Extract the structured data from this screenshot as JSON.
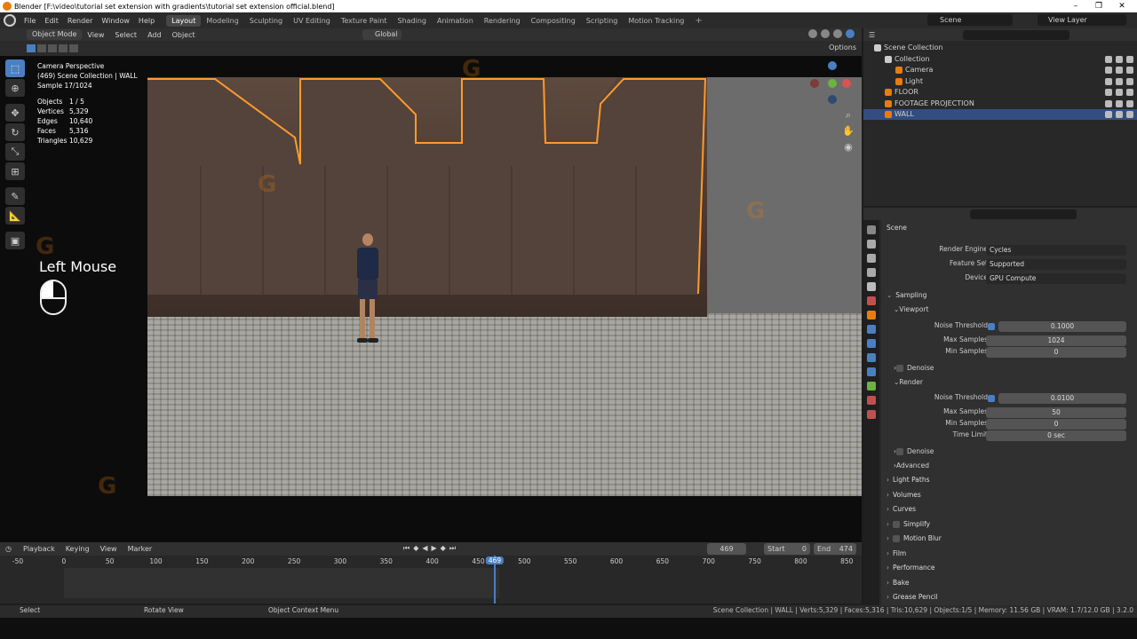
{
  "titlebar": {
    "title": "Blender [F:\\video\\tutorial set extension with gradients\\tutorial set extension official.blend]",
    "min": "–",
    "max": "❐",
    "close": "✕"
  },
  "menubar": {
    "menus": [
      "File",
      "Edit",
      "Render",
      "Window",
      "Help"
    ],
    "workspaces": [
      "Layout",
      "Modeling",
      "Sculpting",
      "UV Editing",
      "Texture Paint",
      "Shading",
      "Animation",
      "Rendering",
      "Compositing",
      "Scripting",
      "Motion Tracking"
    ],
    "active_workspace": "Layout",
    "add": "+",
    "scene": "Scene",
    "view_layer": "View Layer"
  },
  "viewport_header": {
    "mode": "Object Mode",
    "menus": [
      "View",
      "Select",
      "Add",
      "Object"
    ],
    "orientation": "Global",
    "options": "Options"
  },
  "viewport": {
    "info": {
      "perspective": "Camera Perspective",
      "collection": "(469) Scene Collection | WALL",
      "sample": "Sample 17/1024"
    },
    "stats": [
      {
        "label": "Objects",
        "value": "1 / 5"
      },
      {
        "label": "Vertices",
        "value": "5,329"
      },
      {
        "label": "Edges",
        "value": "10,640"
      },
      {
        "label": "Faces",
        "value": "5,316"
      },
      {
        "label": "Triangles",
        "value": "10,629"
      }
    ],
    "overlay_text": "Left Mouse",
    "tools": [
      "select-box-icon",
      "cursor-icon",
      "move-icon",
      "rotate-icon",
      "scale-icon",
      "transform-icon",
      "annotate-icon",
      "measure-icon",
      "add-cube-icon"
    ]
  },
  "timeline": {
    "menus": [
      "Playback",
      "Keying",
      "View",
      "Marker"
    ],
    "current_frame": "469",
    "start_label": "Start",
    "start": "0",
    "end_label": "End",
    "end": "474",
    "ruler": [
      "-50",
      "0",
      "50",
      "100",
      "150",
      "200",
      "250",
      "300",
      "350",
      "400",
      "450",
      "469",
      "500",
      "550",
      "600",
      "650",
      "700",
      "750",
      "800",
      "850"
    ],
    "playhead_frame": 469
  },
  "statusbar": {
    "select": "Select",
    "rotate": "Rotate View",
    "context": "Object Context Menu",
    "stats": "Scene Collection | WALL | Verts:5,329 | Faces:5,316 | Tris:10,629 | Objects:1/5 | Memory: 11.56 GB | VRAM: 1.7/12.0 GB | 3.2.0"
  },
  "outliner": {
    "items": [
      {
        "label": "Scene Collection",
        "indent": 0,
        "icon_color": "#cccccc",
        "selected": false
      },
      {
        "label": "Collection",
        "indent": 1,
        "icon_color": "#cccccc",
        "selected": false
      },
      {
        "label": "Camera",
        "indent": 2,
        "icon_color": "#e87d0d",
        "selected": false
      },
      {
        "label": "Light",
        "indent": 2,
        "icon_color": "#e87d0d",
        "selected": false
      },
      {
        "label": "FLOOR",
        "indent": 1,
        "icon_color": "#e87d0d",
        "selected": false
      },
      {
        "label": "FOOTAGE PROJECTION",
        "indent": 1,
        "icon_color": "#e87d0d",
        "selected": false
      },
      {
        "label": "WALL",
        "indent": 1,
        "icon_color": "#e87d0d",
        "selected": true
      }
    ]
  },
  "properties": {
    "scene": "Scene",
    "render_engine_label": "Render Engine",
    "render_engine": "Cycles",
    "feature_set_label": "Feature Set",
    "feature_set": "Supported",
    "device_label": "Device",
    "device": "GPU Compute",
    "sampling": "Sampling",
    "viewport": "Viewport",
    "render": "Render",
    "noise_threshold_label": "Noise Threshold",
    "max_samples_label": "Max Samples",
    "min_samples_label": "Min Samples",
    "time_limit_label": "Time Limit",
    "viewport_noise": "0.1000",
    "viewport_max": "1024",
    "viewport_min": "0",
    "render_noise": "0.0100",
    "render_max": "50",
    "render_min": "0",
    "render_time_limit": "0 sec",
    "denoise": "Denoise",
    "advanced": "Advanced",
    "sections": [
      "Light Paths",
      "Volumes",
      "Curves",
      "Simplify",
      "Motion Blur",
      "Film",
      "Performance",
      "Bake",
      "Grease Pencil"
    ]
  },
  "colors": {
    "accent": "#4a7fc1",
    "selection_outline": "#ff9a2e",
    "blender_orange": "#e87d0d"
  }
}
